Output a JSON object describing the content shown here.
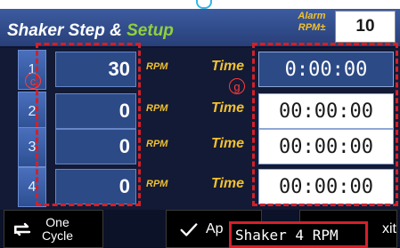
{
  "header": {
    "title_main": "Shaker Step",
    "title_amp": "&",
    "title_setup": "Setup",
    "alarm_label_line1": "Alarm",
    "alarm_label_line2": "RPM±",
    "alarm_value": "10"
  },
  "steps": [
    {
      "number": "1",
      "rpm": "30",
      "rpm_unit": "RPM",
      "time_label": "Time",
      "time": "0:00:00"
    },
    {
      "number": "2",
      "rpm": "0",
      "rpm_unit": "RPM",
      "time_label": "Time",
      "time": "00:00:00"
    },
    {
      "number": "3",
      "rpm": "0",
      "rpm_unit": "RPM",
      "time_label": "Time",
      "time": "00:00:00"
    },
    {
      "number": "4",
      "rpm": "0",
      "rpm_unit": "RPM",
      "time_label": "Time",
      "time": "00:00:00"
    }
  ],
  "annotations": {
    "left_marker": "c",
    "right_marker": "g"
  },
  "footer": {
    "cycle_line1": "One",
    "cycle_line2": "Cycle",
    "apply_label": "Ap",
    "exit_label": "xit"
  },
  "tooltip": "Shaker 4 RPM",
  "colors": {
    "background": "#131a35",
    "accent_yellow": "#f2c12e",
    "setup_green": "#8fd13c",
    "annotation_red": "#d3202a"
  }
}
